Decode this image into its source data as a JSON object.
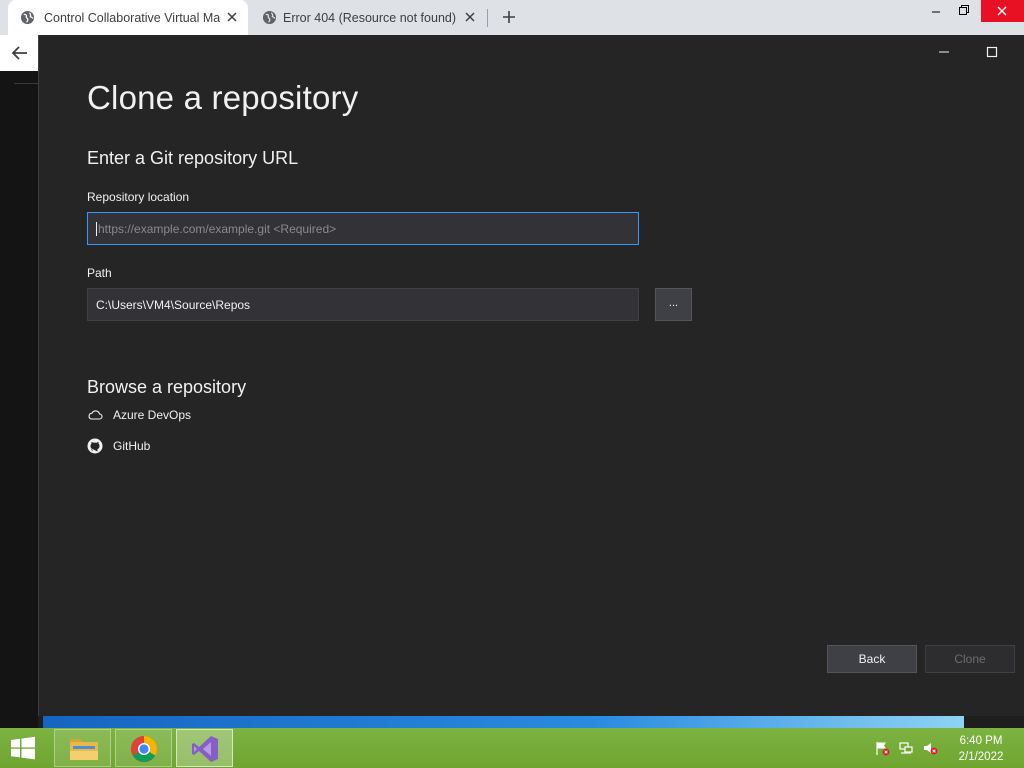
{
  "browser": {
    "tabs": [
      {
        "title": "Control Collaborative Virtual Ma",
        "active": true
      },
      {
        "title": "Error 404 (Resource not found)",
        "active": false
      }
    ]
  },
  "dialog": {
    "title": "Clone a repository",
    "url_section": {
      "heading": "Enter a Git repository URL",
      "repo_location_label": "Repository location",
      "repo_location_placeholder": "https://example.com/example.git <Required>",
      "repo_location_value": "",
      "path_label": "Path",
      "path_value": "C:\\Users\\VM4\\Source\\Repos",
      "browse_button": "..."
    },
    "browse_section": {
      "heading": "Browse a repository",
      "items": [
        {
          "label": "Azure DevOps",
          "icon": "cloud-icon"
        },
        {
          "label": "GitHub",
          "icon": "github-icon"
        }
      ]
    },
    "buttons": {
      "back": "Back",
      "clone": "Clone"
    }
  },
  "taskbar": {
    "apps": [
      {
        "name": "File Explorer",
        "icon": "folder-icon"
      },
      {
        "name": "Google Chrome",
        "icon": "chrome-icon"
      },
      {
        "name": "Visual Studio",
        "icon": "visual-studio-icon"
      }
    ],
    "clock": {
      "time": "6:40 PM",
      "date": "2/1/2022"
    }
  },
  "colors": {
    "dialog_bg": "#252526",
    "input_bg": "#333337",
    "focus_border": "#3399ff",
    "taskbar_green": "#7cb342",
    "vs_purple": "#865fc5"
  }
}
